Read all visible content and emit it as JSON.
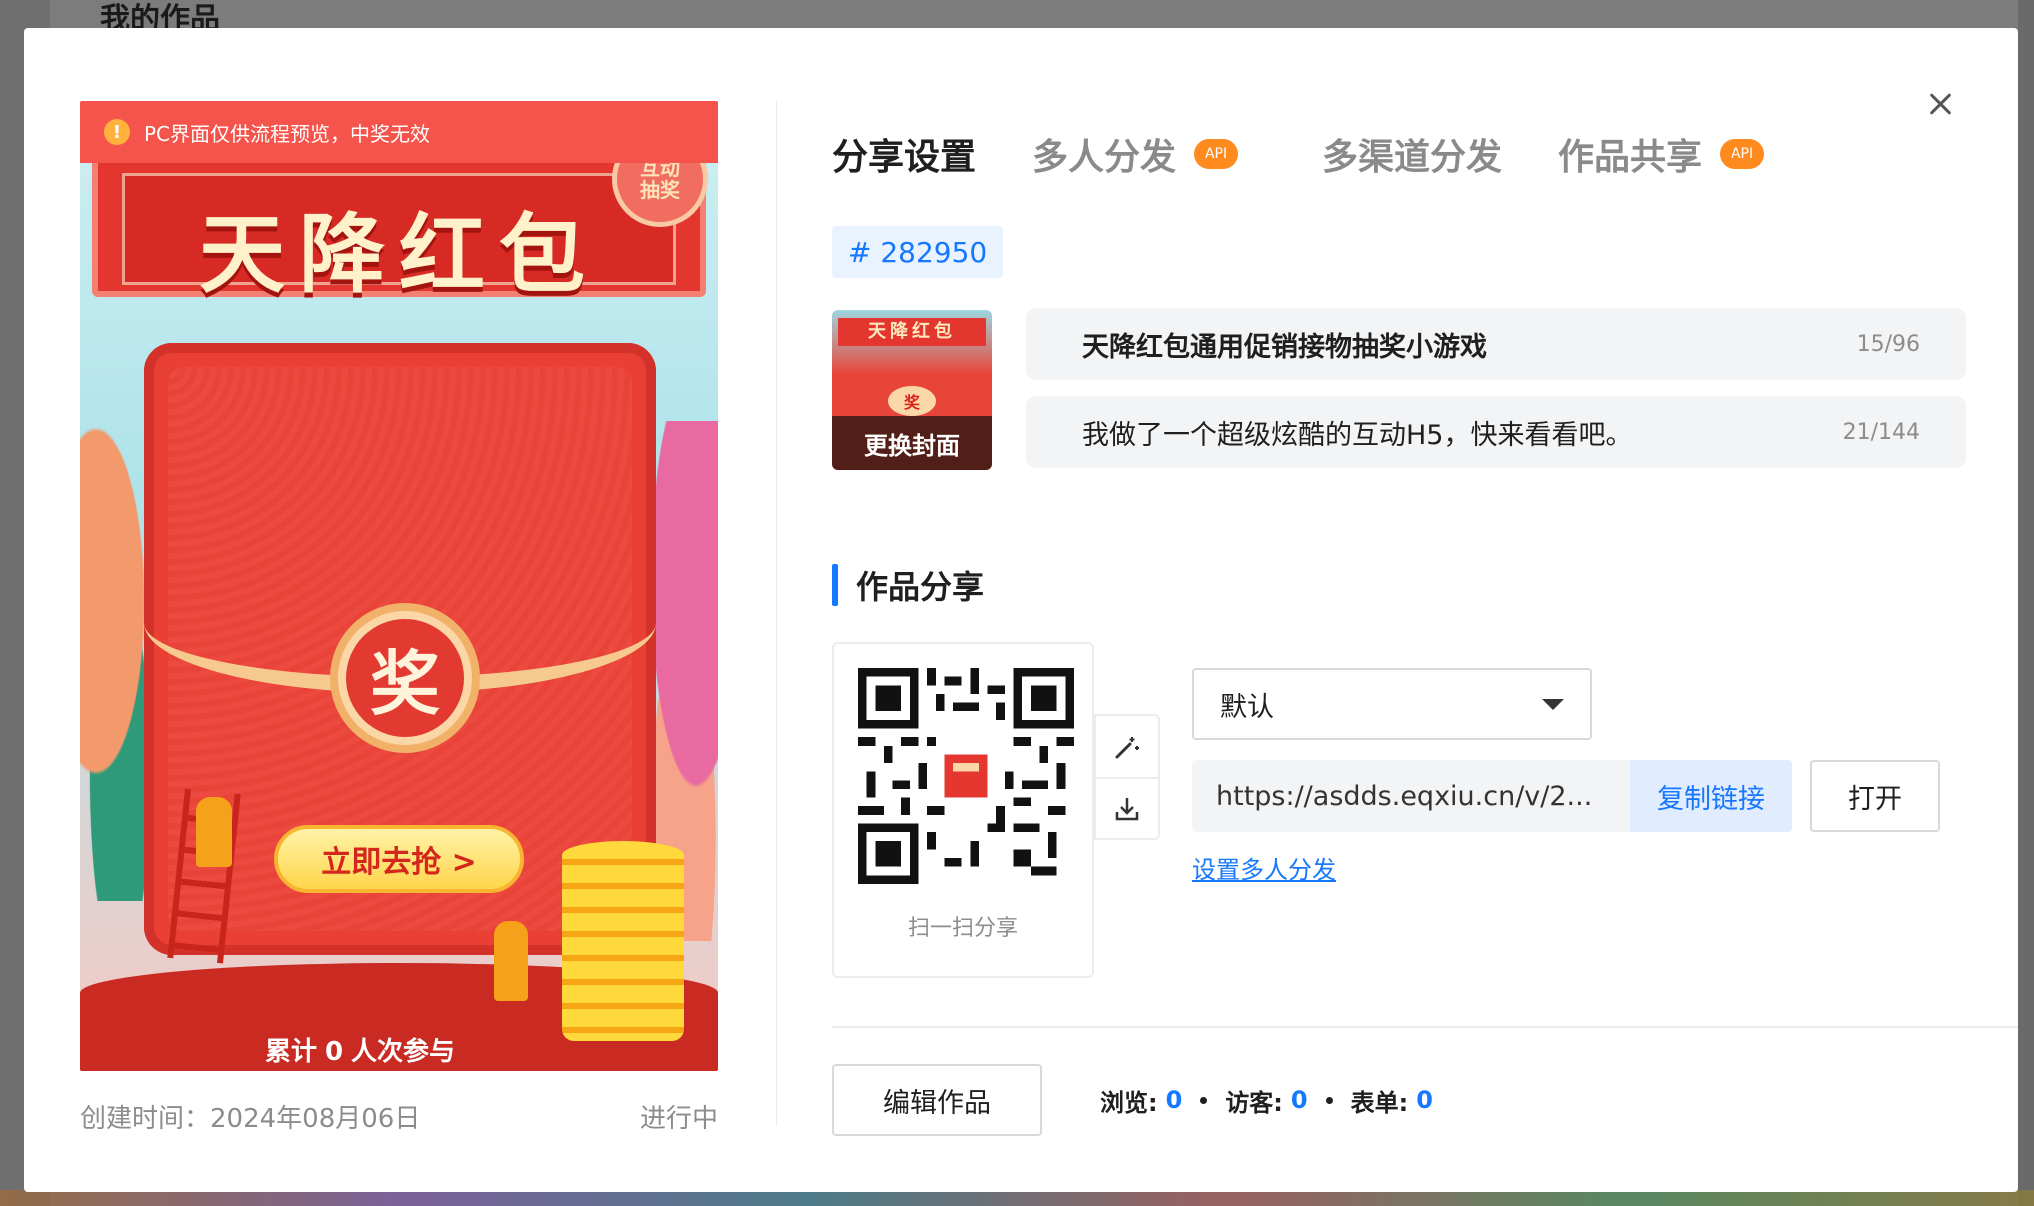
{
  "background": {
    "title": "我的作品"
  },
  "preview": {
    "warning": "PC界面仅供流程预览，中奖无效",
    "banner_title": "天降红包",
    "badge_text": "互动\n抽奖",
    "seal_char": "奖",
    "cta_label": "立即去抢 >",
    "counter_prefix": "累计",
    "counter_value": "0",
    "counter_suffix": "人次参与",
    "created_label": "创建时间：2024年08月06日",
    "status": "进行中"
  },
  "tabs": [
    {
      "label": "分享设置",
      "active": true
    },
    {
      "label": "多人分发",
      "badge": "API"
    },
    {
      "label": "多渠道分发"
    },
    {
      "label": "作品共享",
      "badge": "API"
    }
  ],
  "work_id": "# 282950",
  "cover": {
    "title": "天降红包",
    "seal": "奖",
    "change_label": "更换封面"
  },
  "title_field": {
    "value": "天降红包通用促销接物抽奖小游戏",
    "count": "15/96"
  },
  "desc_field": {
    "value": "我做了一个超级炫酷的互动H5，快来看看吧。",
    "count": "21/144"
  },
  "share_section": {
    "title": "作品分享",
    "qr_caption": "扫一扫分享",
    "select_value": "默认",
    "link": "https://asdds.eqxiu.cn/v/2...",
    "copy_label": "复制链接",
    "open_label": "打开",
    "multi_link": "设置多人分发"
  },
  "footer": {
    "edit_label": "编辑作品",
    "stats": [
      {
        "label": "浏览:",
        "value": "0"
      },
      {
        "label": "访客:",
        "value": "0"
      },
      {
        "label": "表单:",
        "value": "0"
      }
    ]
  },
  "colors": {
    "accent": "#1677ff",
    "api_badge": "#ff8a1e",
    "warning_bar": "#f4544c"
  }
}
